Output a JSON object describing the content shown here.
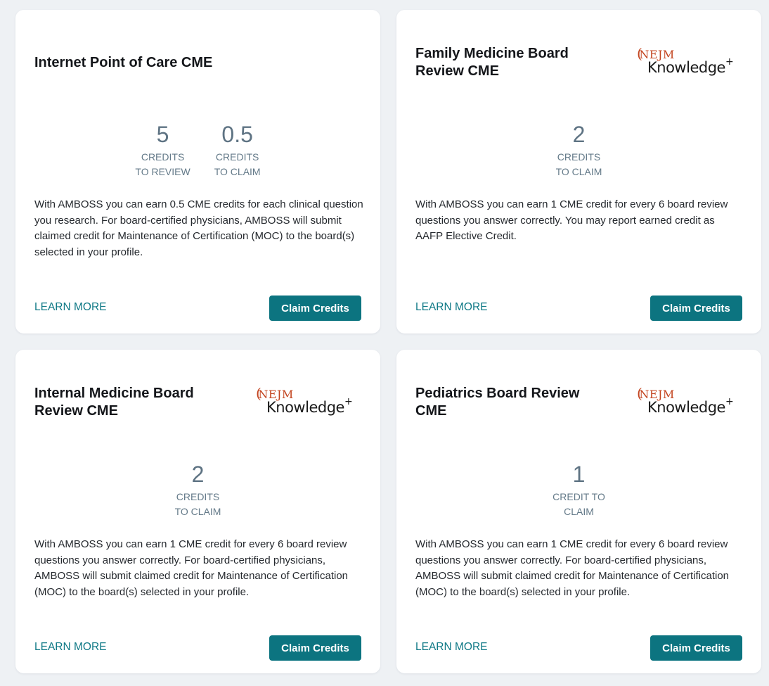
{
  "cards": [
    {
      "title": "Internet Point of Care CME",
      "credits": [
        {
          "value": "5",
          "label_line1": "CREDITS",
          "label_line2": "TO REVIEW"
        },
        {
          "value": "0.5",
          "label_line1": "CREDITS",
          "label_line2": "TO CLAIM"
        }
      ],
      "description": "With AMBOSS you can earn 0.5 CME credits for each clinical question you research. For board-certified physicians, AMBOSS will submit claimed credit for Maintenance of Certification (MOC) to the board(s) selected in your profile.",
      "learn_more": "LEARN MORE",
      "claim_button": "Claim Credits"
    },
    {
      "title": "Family Medicine Board Review CME",
      "logo": {
        "nejm": "NEJM",
        "knowledge": "Knowledge",
        "plus": "+"
      },
      "credits": [
        {
          "value": "2",
          "label_line1": "CREDITS",
          "label_line2": "TO CLAIM"
        }
      ],
      "description": "With AMBOSS you can earn 1 CME credit for every 6 board review questions you answer correctly. You may report earned credit as AAFP Elective Credit.",
      "learn_more": "LEARN MORE",
      "claim_button": "Claim Credits"
    },
    {
      "title": "Internal Medicine Board Review CME",
      "logo": {
        "nejm": "NEJM",
        "knowledge": "Knowledge",
        "plus": "+"
      },
      "credits": [
        {
          "value": "2",
          "label_line1": "CREDITS",
          "label_line2": "TO CLAIM"
        }
      ],
      "description": "With AMBOSS you can earn 1 CME credit for every 6 board review questions you answer correctly. For board-certified physicians, AMBOSS will submit claimed credit for Maintenance of Certification (MOC) to the board(s) selected in your profile.",
      "learn_more": "LEARN MORE",
      "claim_button": "Claim Credits"
    },
    {
      "title": "Pediatrics Board Review CME",
      "logo": {
        "nejm": "NEJM",
        "knowledge": "Knowledge",
        "plus": "+"
      },
      "credits": [
        {
          "value": "1",
          "label_line1": "CREDIT TO",
          "label_line2": "CLAIM"
        }
      ],
      "description": "With AMBOSS you can earn 1 CME credit for every 6 board review questions you answer correctly. For board-certified physicians, AMBOSS will submit claimed credit for Maintenance of Certification (MOC) to the board(s) selected in your profile.",
      "learn_more": "LEARN MORE",
      "claim_button": "Claim Credits"
    }
  ],
  "colors": {
    "accent": "#0c7480",
    "link": "#0f7986",
    "nejm_red": "#c3441f",
    "credit_text": "#5e7383",
    "background": "#eef1f4"
  }
}
